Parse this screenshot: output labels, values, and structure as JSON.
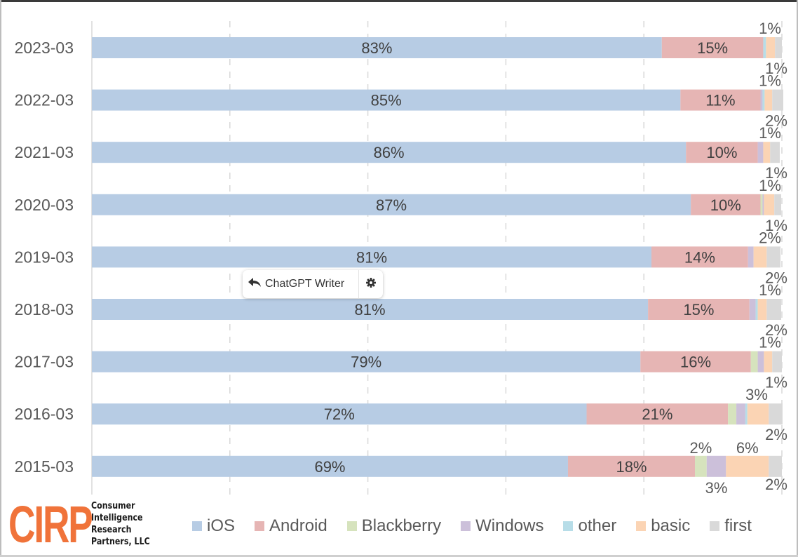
{
  "chart_data": {
    "type": "bar",
    "orientation": "horizontal",
    "stacked": true,
    "normalized_percent": true,
    "title": "",
    "xlabel": "",
    "ylabel": "",
    "xlim": [
      0,
      100
    ],
    "grid": true,
    "legend_position": "bottom",
    "categories": [
      "2023-03",
      "2022-03",
      "2021-03",
      "2020-03",
      "2019-03",
      "2018-03",
      "2017-03",
      "2016-03",
      "2015-03"
    ],
    "series": [
      {
        "name": "iOS",
        "color": "#b7cce4",
        "values": [
          82.6,
          85.3,
          86.1,
          86.8,
          81.1,
          80.6,
          79.5,
          71.7,
          69.0
        ]
      },
      {
        "name": "Android",
        "color": "#e6b5b4",
        "values": [
          14.7,
          11.6,
          10.4,
          10.1,
          14.0,
          14.7,
          16.0,
          20.5,
          18.4
        ]
      },
      {
        "name": "Blackberry",
        "color": "#d6e3bd",
        "values": [
          0,
          0,
          0,
          0.3,
          0,
          0,
          1.0,
          1.2,
          1.7
        ]
      },
      {
        "name": "Windows",
        "color": "#ccc0da",
        "values": [
          0,
          0.3,
          0.8,
          0.2,
          0.8,
          0.9,
          0.9,
          1.3,
          2.8
        ]
      },
      {
        "name": "other",
        "color": "#b7dde8",
        "values": [
          0.4,
          0.3,
          0,
          0,
          0,
          0.3,
          0,
          0.3,
          0
        ]
      },
      {
        "name": "basic",
        "color": "#fbd4b4",
        "values": [
          1.3,
          1.1,
          1.0,
          1.5,
          1.9,
          1.3,
          1.2,
          3.1,
          6.2
        ]
      },
      {
        "name": "first",
        "color": "#d9d9d9",
        "values": [
          1.0,
          1.6,
          1.4,
          1.0,
          2.0,
          2.1,
          1.4,
          2.0,
          1.9
        ]
      }
    ],
    "data_labels": [
      {
        "category": "2023-03",
        "inside": {
          "iOS": "83%",
          "Android": "15%"
        },
        "above": "1%",
        "below": "1%"
      },
      {
        "category": "2022-03",
        "inside": {
          "iOS": "85%",
          "Android": "11%"
        },
        "above": "1%",
        "below": "2%"
      },
      {
        "category": "2021-03",
        "inside": {
          "iOS": "86%",
          "Android": "10%"
        },
        "above": "1%",
        "below": "1%"
      },
      {
        "category": "2020-03",
        "inside": {
          "iOS": "87%",
          "Android": "10%"
        },
        "above": "1%",
        "below": "1%"
      },
      {
        "category": "2019-03",
        "inside": {
          "iOS": "81%",
          "Android": "14%"
        },
        "above": "2%",
        "below": "2%"
      },
      {
        "category": "2018-03",
        "inside": {
          "iOS": "81%",
          "Android": "15%"
        },
        "above": "1%",
        "below": "2%"
      },
      {
        "category": "2017-03",
        "inside": {
          "iOS": "79%",
          "Android": "16%"
        },
        "above": "1%",
        "below": "1%"
      },
      {
        "category": "2016-03",
        "inside": {
          "iOS": "72%",
          "Android": "21%"
        },
        "above": "3%",
        "below": "2%"
      },
      {
        "category": "2015-03",
        "inside": {
          "iOS": "69%",
          "Android": "18%"
        },
        "above": "2%",
        "above2": "6%",
        "below": "3%",
        "below2": "2%"
      }
    ]
  },
  "legend": [
    {
      "label": "iOS",
      "color": "#b7cce4"
    },
    {
      "label": "Android",
      "color": "#e6b5b4"
    },
    {
      "label": "Blackberry",
      "color": "#d6e3bd"
    },
    {
      "label": "Windows",
      "color": "#ccc0da"
    },
    {
      "label": "other",
      "color": "#b7dde8"
    },
    {
      "label": "basic",
      "color": "#fbd4b4"
    },
    {
      "label": "first",
      "color": "#d9d9d9"
    }
  ],
  "logo": {
    "mark": "CIRP",
    "lines": [
      "Consumer",
      "Intelligence",
      "Research",
      "Partners, LLC"
    ],
    "color": "#f0733a"
  },
  "popup": {
    "label": "ChatGPT Writer",
    "icon": "reply-icon",
    "settings_icon": "gear-icon"
  }
}
